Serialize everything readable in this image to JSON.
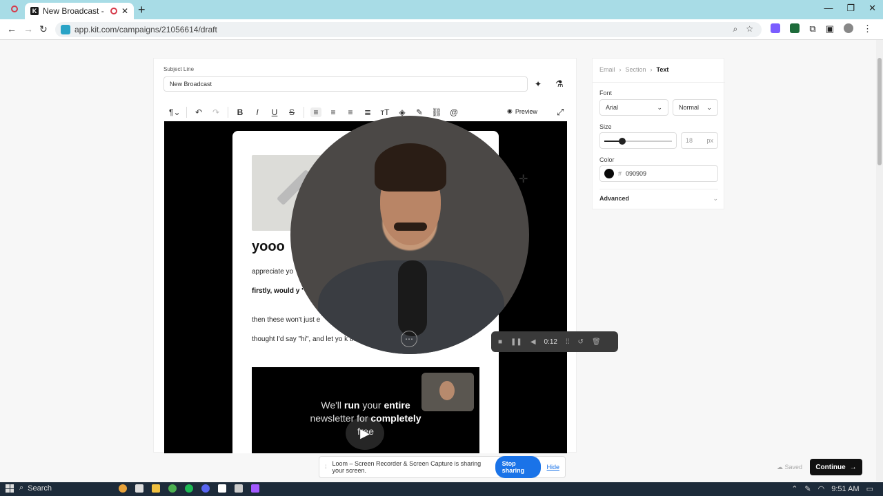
{
  "browser": {
    "tab_title": "New Broadcast - Kit",
    "tab_favicon": "K",
    "url": "app.kit.com/campaigns/21056614/draft"
  },
  "editor": {
    "subject_label": "Subject Line",
    "subject_value": "New Broadcast",
    "preview_label": "Preview",
    "email": {
      "heading": "yooo",
      "p1": "appreciate yo",
      "p2": "firstly, would y \"write\"?",
      "p3": "then these won't just e",
      "p4": "thought I'd say \"hi\", and let yo                    k the button if you want a little personal",
      "video_text_1": "We'll",
      "video_text_run": "run",
      "video_text_2": "your",
      "video_text_entire": "entire",
      "video_text_3": "newsletter for",
      "video_text_completely": "completely",
      "video_text_4": "free"
    }
  },
  "recorder": {
    "time": "0:12"
  },
  "panel": {
    "crumbs": [
      "Email",
      "Section",
      "Text"
    ],
    "font_label": "Font",
    "font_family": "Arial",
    "font_weight": "Normal",
    "size_label": "Size",
    "size_value": "18",
    "size_unit": "px",
    "size_slider_fraction": 0.27,
    "color_label": "Color",
    "color_hash": "#",
    "color_value": "090909",
    "color_hex": "#090909",
    "advanced_label": "Advanced"
  },
  "share": {
    "message": "Loom – Screen Recorder & Screen Capture is sharing your screen.",
    "stop_label": "Stop sharing",
    "hide_label": "Hide"
  },
  "footer": {
    "saved_label": "Saved",
    "continue_label": "Continue"
  },
  "taskbar": {
    "search_label": "Search",
    "clock": "9:51 AM"
  }
}
